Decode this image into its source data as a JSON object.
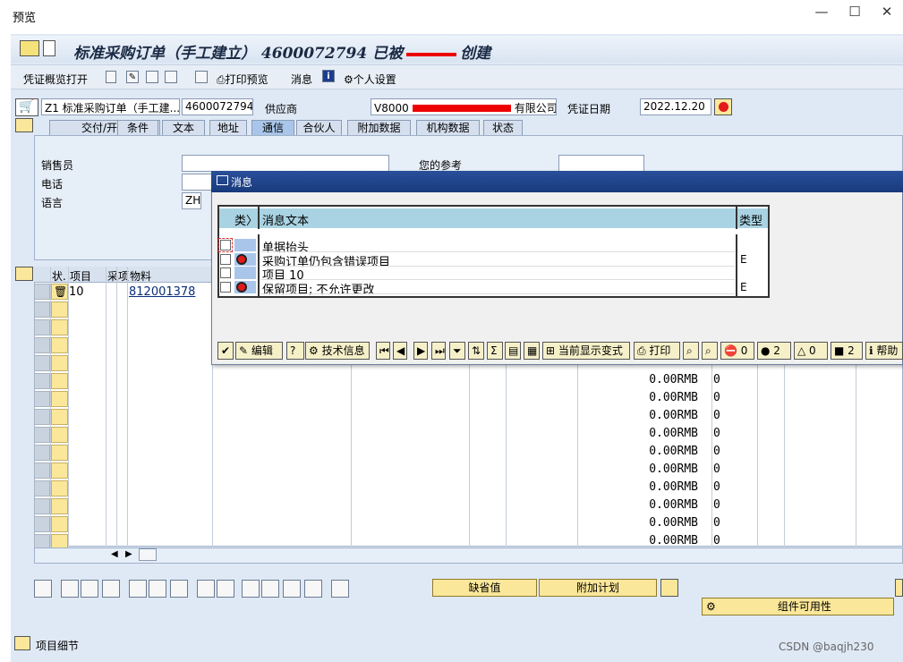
{
  "window": {
    "title": "预览",
    "minimize": "—",
    "maximize": "☐",
    "close": "✕"
  },
  "header": {
    "title": "标准采购订单（手工建立） 4600072794 已被",
    "title_suffix": "创建"
  },
  "toolbar": {
    "overview": "凭证概览打开",
    "print_preview": "打印预览",
    "messages": "消息",
    "personal": "个人设置"
  },
  "doc": {
    "type": "Z1 标准采购订单（手工建...",
    "number": "4600072794",
    "vendor_label": "供应商",
    "vendor_value": "V8000",
    "vendor_suffix": "有限公司",
    "date_label": "凭证日期",
    "date_value": "2022.12.20"
  },
  "tabs": [
    "交付/开票",
    "条件",
    "文本",
    "地址",
    "通信",
    "合伙人",
    "附加数据",
    "机构数据",
    "状态"
  ],
  "comm": {
    "sales_label": "销售员",
    "phone_label": "电话",
    "lang_label": "语言",
    "lang_value": "ZH",
    "ref_label": "您的参考"
  },
  "grid": {
    "headers": [
      "状.",
      "项目",
      "采",
      "项",
      "物料"
    ],
    "first_item": "10",
    "first_material": "812001378",
    "amounts": [
      "0.00RMB",
      "0.00RMB",
      "0.00RMB",
      "0.00RMB",
      "0.00RMB",
      "0.00RMB",
      "0.00RMB",
      "0.00RMB",
      "0.00RMB",
      "0.00RMB"
    ],
    "zero": "0"
  },
  "dialog": {
    "title": "消息",
    "col_type": "类",
    "col_text": "消息文本",
    "col_kind": "类型",
    "messages": [
      {
        "text": "单据抬头",
        "kind": ""
      },
      {
        "text": "采购订单仍包含错误项目",
        "kind": "E"
      },
      {
        "text": "项目 10",
        "kind": ""
      },
      {
        "text": "保留项目; 不允许更改",
        "kind": "E"
      }
    ],
    "buttons": {
      "edit": "编辑",
      "tech": "技术信息",
      "current_var": "当前显示变式",
      "print": "打印",
      "help": "帮助",
      "stop_count": "0",
      "error_count": "2",
      "warn_count": "0",
      "ok_count": "2"
    }
  },
  "bottom": {
    "default_btn": "缺省值",
    "plan_btn": "附加计划",
    "avail_btn": "组件可用性",
    "item_detail": "项目细节",
    "watermark": "CSDN @baqjh230"
  }
}
